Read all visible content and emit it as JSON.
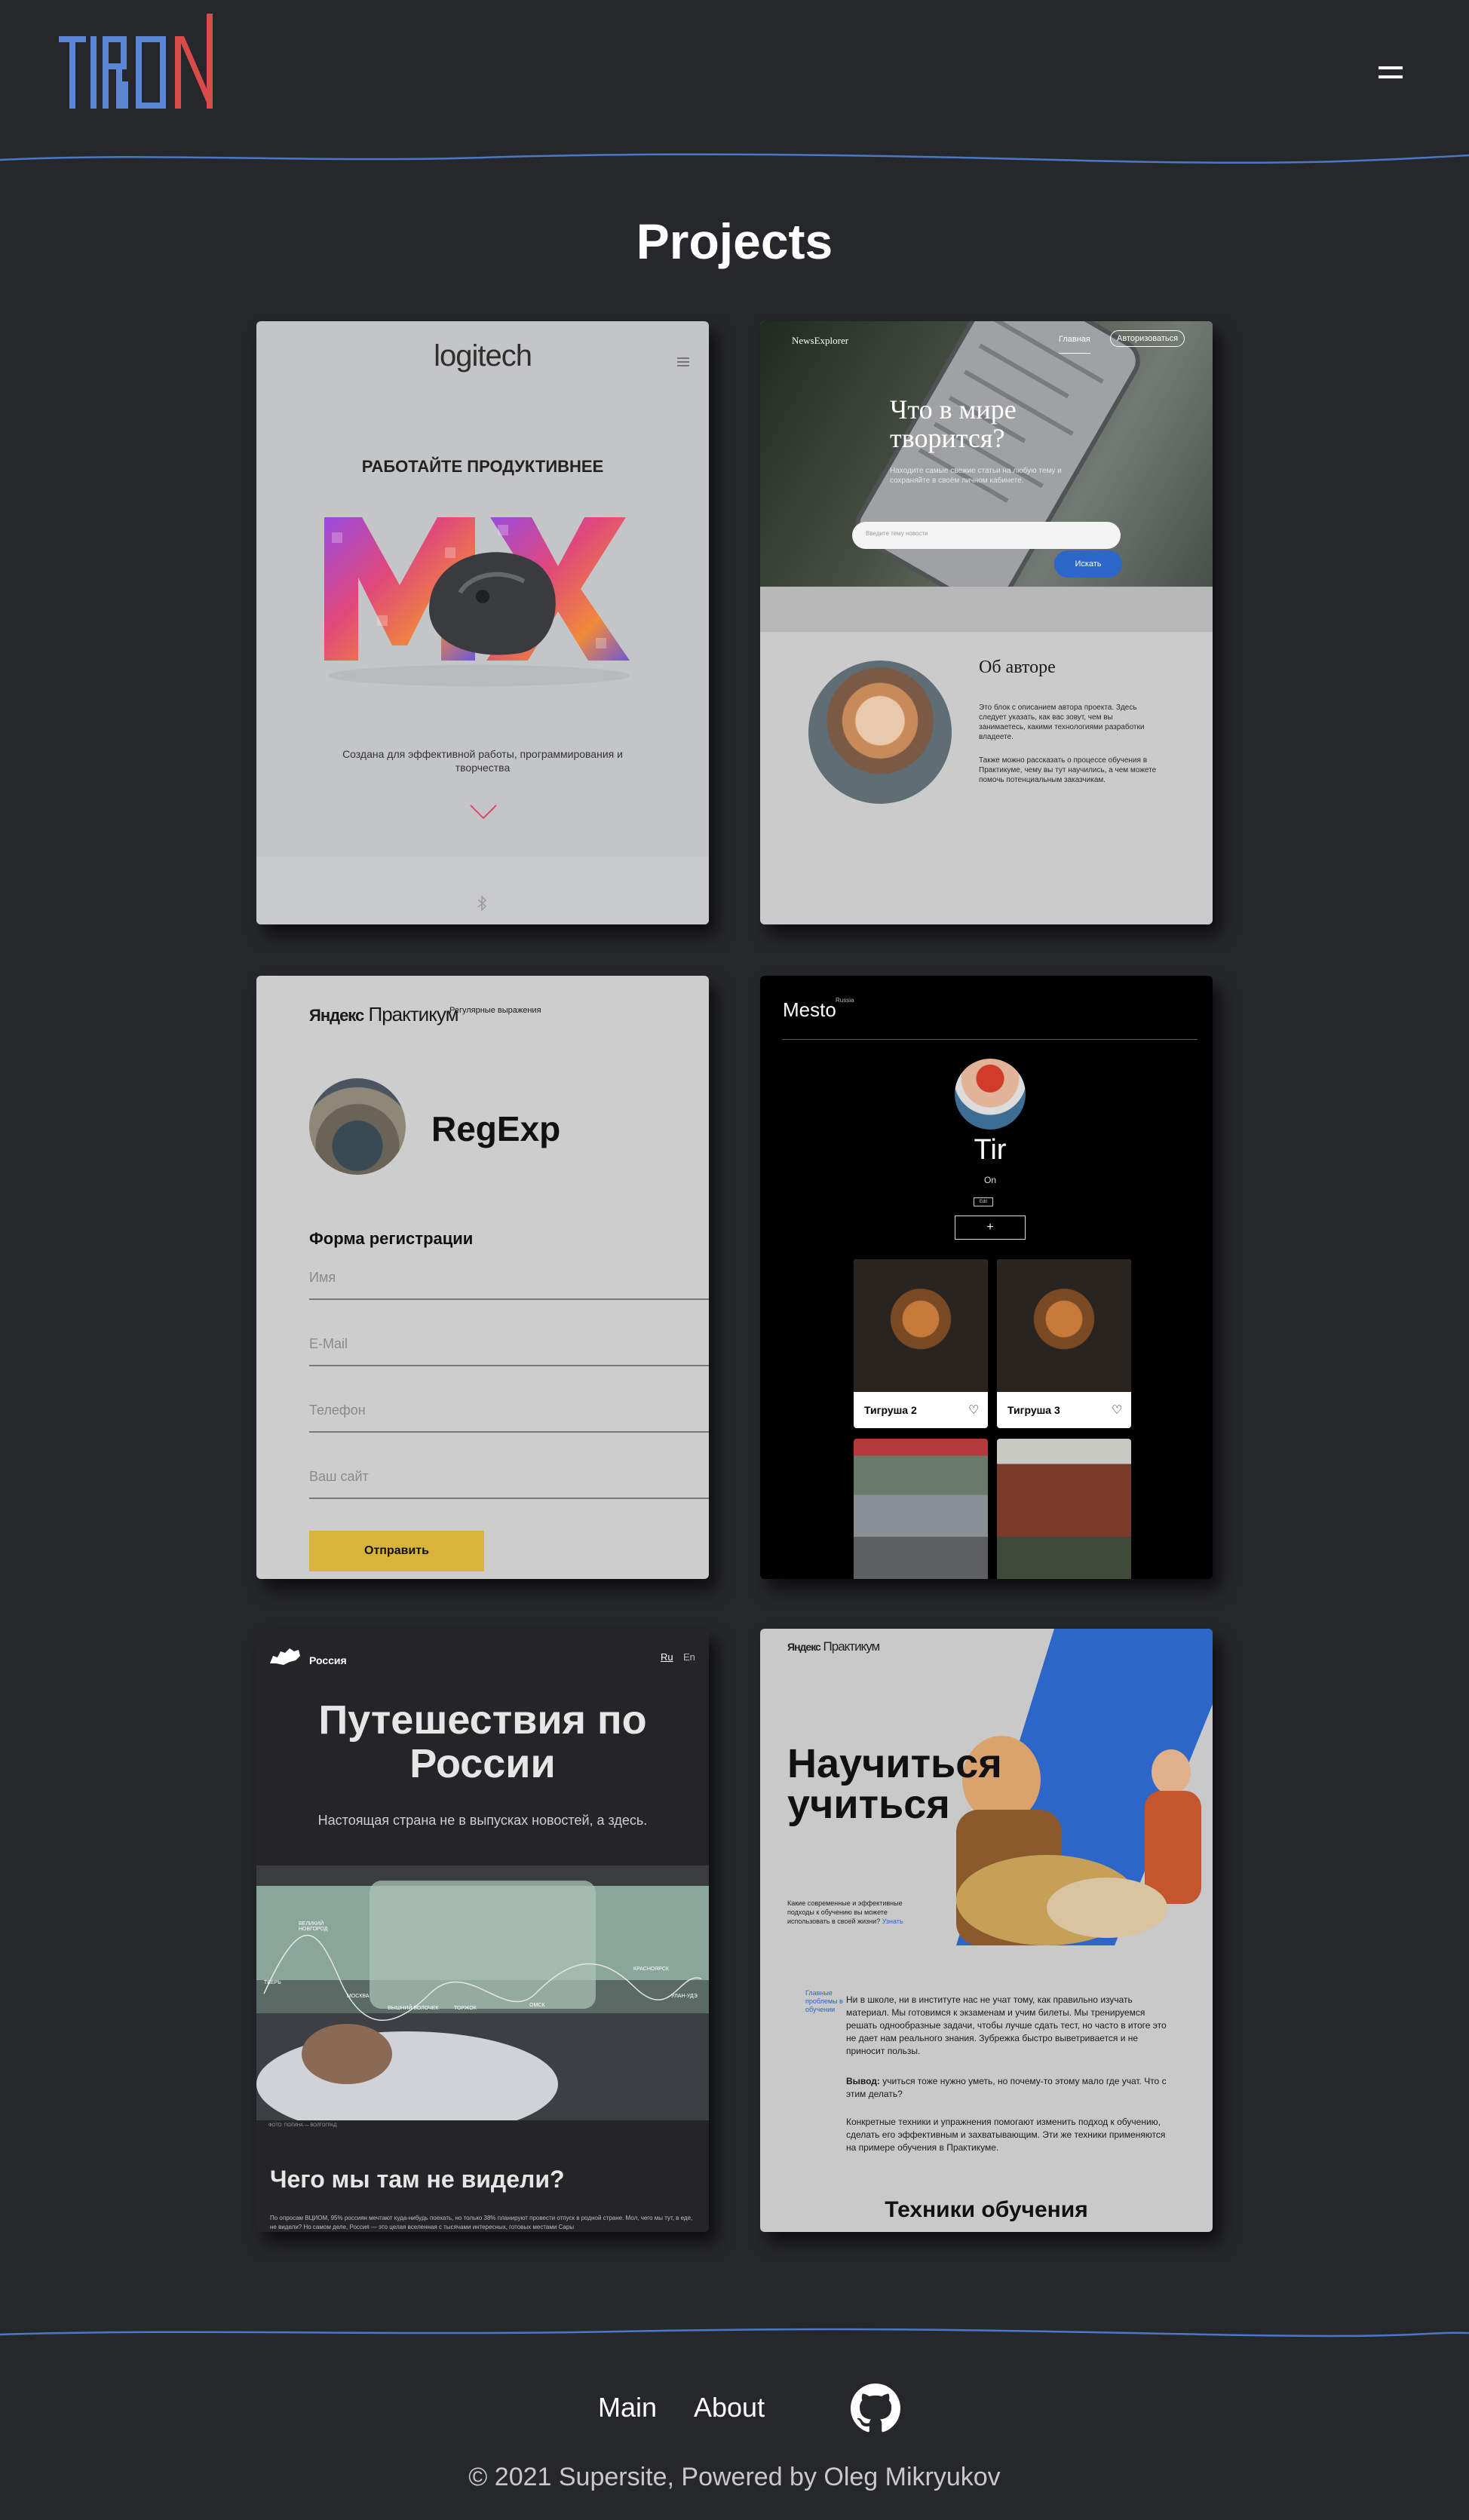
{
  "header": {
    "logo_text": "TIRON",
    "menu_icon": "hamburger-menu-icon"
  },
  "main": {
    "title": "Projects",
    "cards": [
      {
        "brand": "logitech",
        "headline": "РАБОТАЙТЕ ПРОДУКТИВНЕЕ",
        "caption": "Создана для эффективной работы, программирования и творчества",
        "icons": [
          "menu-icon",
          "chevron-down-icon",
          "bluetooth-icon"
        ]
      },
      {
        "brand": "NewsExplorer",
        "nav_main": "Главная",
        "nav_auth": "Авторизоваться",
        "headline": "Что в мире творится?",
        "subhead": "Находите самые свежие статьи на любую тему и сохраняйте в своём личном кабинете.",
        "search_placeholder": "Введите тему новости",
        "search_button": "Искать",
        "about_title": "Об авторе",
        "about_p1": "Это блок с описанием автора проекта. Здесь следует указать, как вас зовут, чем вы занимаетесь, какими технологиями разработки владеете.",
        "about_p2": "Также можно рассказать о процессе обучения в Практикуме, чему вы тут научились, а чем можете помочь потенциальным заказчикам."
      },
      {
        "brand_a": "Яндекс",
        "brand_b": "Практикум",
        "tag": "Регулярные выражения",
        "title": "RegExp",
        "form_title": "Форма регистрации",
        "fields": [
          "Имя",
          "E-Mail",
          "Телефон",
          "Ваш сайт"
        ],
        "submit": "Отправить"
      },
      {
        "brand": "Mesto",
        "brand_sup": "Russia",
        "name": "Tir",
        "about": "On",
        "edit_label": "Edit",
        "add_label": "+",
        "places": [
          {
            "title": "Тигруша 2"
          },
          {
            "title": "Тигруша 3"
          }
        ]
      },
      {
        "brand": "Россия",
        "lang_ru": "Ru",
        "lang_en": "En",
        "headline": "Путешествия по России",
        "subhead": "Настоящая страна не в выпусках новостей, а здесь.",
        "route_labels": [
          "ВЕЛИКИЙ НОВГОРОД",
          "ТВЕРЬ",
          "ВЫШНИЙ ВОЛОЧЕК",
          "МОСКВА",
          "ТОРЖОК",
          "ОМСК",
          "КРАСНОЯРСК",
          "УЛАН-УДЭ"
        ],
        "photo_credit": "ФОТО: ПОЛИНА — ВОЛГОГРАД",
        "section_title": "Чего мы там не видели?",
        "section_text": "По опросам ВЦИОМ, 95% россиян мечтают куда-нибудь поехать, но только 38% планируют провести отпуск в родной стране. Мол, чего мы тут, в еде, не видели? Но самом деле, Россия — это целая вселенная с тысячами интересных, готовых местами Сары"
      },
      {
        "brand_a": "Яндекс",
        "brand_b": "Практикум",
        "headline": "Научиться учиться",
        "intro": "Какие современные и эффективные подходы к обучению вы можете использовать в своей жизни?",
        "intro_link": "Узнать",
        "side_note": "Главные проблемы в обучении",
        "p1": "Ни в школе, ни в институте нас не учат тому, как правильно изучать материал. Мы готовимся к экзаменам и учим билеты. Мы тренируемся решать однообразные задачи, чтобы лучше сдать тест, но часто в итоге это не дает нам реального знания. Зубрежка быстро выветривается и не приносит пользы.",
        "p2_bold": "Вывод:",
        "p2": " учиться тоже нужно уметь, но почему-то этому мало где учат. Что с этим делать?",
        "p3": "Конкретные техники и упражнения помогают изменить подход к обучению, сделать его эффективным и захватывающим. Эти же техники применяются на примере обучения в Практикуме.",
        "section_title": "Техники обучения"
      }
    ]
  },
  "footer": {
    "links": [
      "Main",
      "About"
    ],
    "github_icon": "github-icon",
    "copyright": "© 2021 Supersite, Powered by Oleg Mikryukov"
  },
  "colors": {
    "background": "#26272b",
    "logo_blue": "#5b86d8",
    "logo_red": "#d94a4a",
    "rule_blue": "#4a78c9",
    "accent_yellow": "#d8b53a",
    "accent_blue": "#2c66c8"
  }
}
